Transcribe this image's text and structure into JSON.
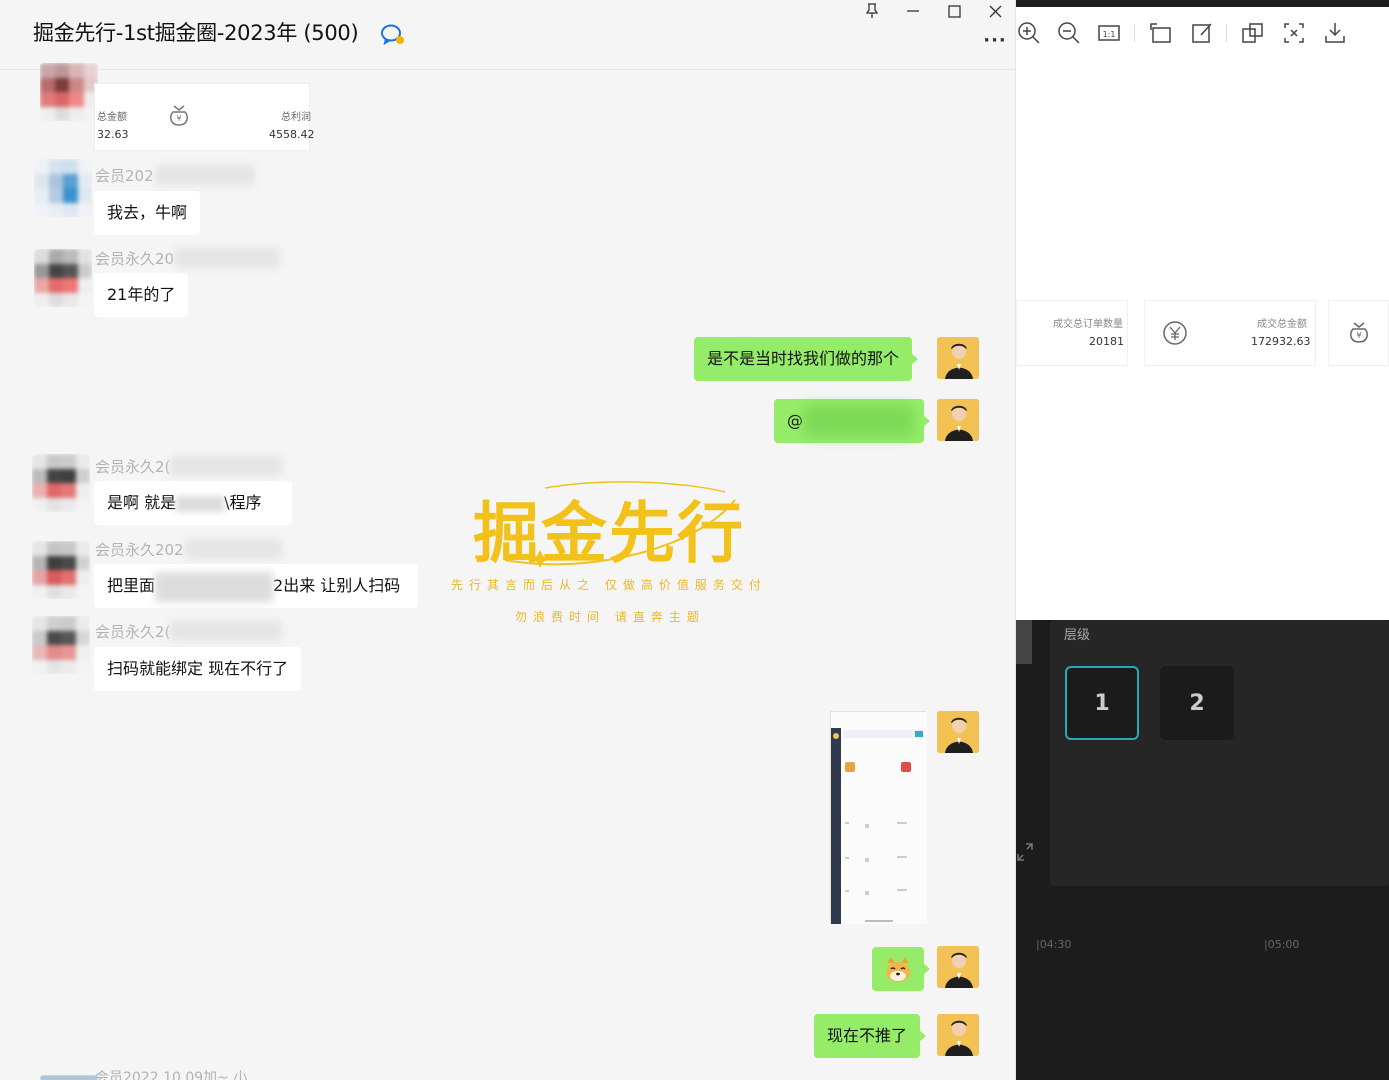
{
  "window": {
    "title": "掘金先行-1st掘金圈-2023年 (500)",
    "controls": {
      "pin": "⊼",
      "minimize": "—",
      "maximize": "☐",
      "close": "✕",
      "more": "···"
    }
  },
  "messages": {
    "card_1": {
      "label_left": "总金额",
      "value_left": "32.63",
      "label_right": "总利润",
      "value_right": "4558.42"
    },
    "m2": {
      "nick": "会员202",
      "text": "我去，牛啊"
    },
    "m3": {
      "nick": "会员永久20",
      "text": "21年的了"
    },
    "m4": {
      "text": "是不是当时找我们做的那个"
    },
    "m5": {
      "text": "@"
    },
    "m6": {
      "nick": "会员永久2(",
      "text_a": "是啊  就是",
      "text_b": "\\程序"
    },
    "m7": {
      "nick": "会员永久202",
      "text_a": "把里面",
      "text_b": "2出来 让别人扫码"
    },
    "m8": {
      "nick": "会员永久2(",
      "text": "扫码就能绑定   现在不行了"
    },
    "m9": {
      "text": "😊"
    },
    "m10": {
      "text": "现在不推了"
    },
    "m11": {
      "nick": "会员2022.10.09加~ 小"
    }
  },
  "watermark": {
    "title": "掘金先行",
    "line1": "先行其言而后从之  仅做高价值服务交付",
    "line2": "勿浪费时间  请直奔主题"
  },
  "viewer": {
    "stat1_label": "成交总订单数量",
    "stat1_value": "20181",
    "stat2_label": "成交总金额",
    "stat2_value": "172932.63"
  },
  "editor": {
    "panel_label": "层级",
    "layer_1": "1",
    "layer_2": "2",
    "tick_1": "|04:30",
    "tick_2": "|05:00"
  },
  "colors": {
    "me_bubble": "#95ec69",
    "other_bubble": "#ffffff",
    "accent_teal": "#2aa8b4",
    "watermark": "#f2c21a"
  }
}
